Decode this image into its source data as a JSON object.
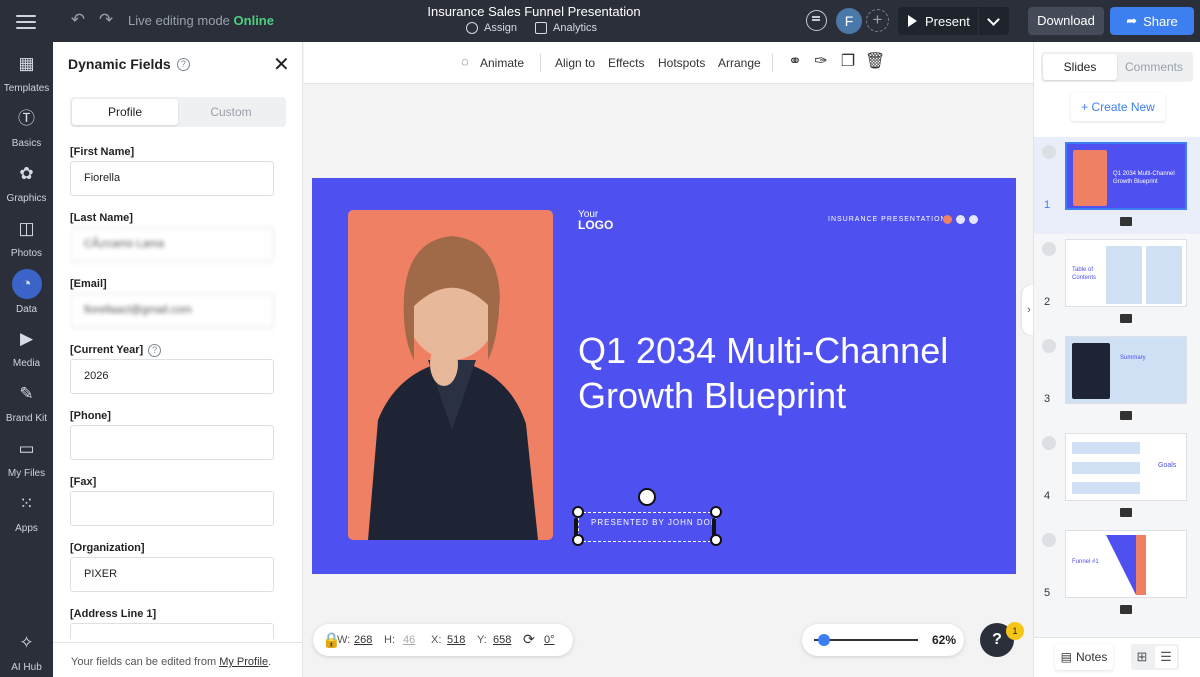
{
  "topbar": {
    "live_label": "Live editing mode",
    "live_status": "Online",
    "doc_title": "Insurance Sales Funnel Presentation",
    "assign": "Assign",
    "analytics": "Analytics",
    "avatar_initial": "F",
    "present": "Present",
    "download": "Download",
    "share": "Share"
  },
  "rail": [
    {
      "label": "Templates",
      "icon": "templates-icon"
    },
    {
      "label": "Basics",
      "icon": "basics-icon"
    },
    {
      "label": "Graphics",
      "icon": "graphics-icon"
    },
    {
      "label": "Photos",
      "icon": "photos-icon"
    },
    {
      "label": "Data",
      "icon": "data-icon"
    },
    {
      "label": "Media",
      "icon": "media-icon"
    },
    {
      "label": "Brand Kit",
      "icon": "brand-kit-icon"
    },
    {
      "label": "My Files",
      "icon": "my-files-icon"
    },
    {
      "label": "Apps",
      "icon": "apps-icon"
    },
    {
      "label": "AI Hub",
      "icon": "ai-hub-icon"
    }
  ],
  "panel": {
    "title": "Dynamic Fields",
    "tab_profile": "Profile",
    "tab_custom": "Custom",
    "fields": [
      {
        "label": "[First Name]",
        "value": "Fiorella"
      },
      {
        "label": "[Last Name]",
        "value": "CÃ¡rcamo Lama"
      },
      {
        "label": "[Email]",
        "value": "fiorellaacl@gmail.com"
      },
      {
        "label": "[Current Year]",
        "value": "2026"
      },
      {
        "label": "[Phone]",
        "value": ""
      },
      {
        "label": "[Fax]",
        "value": ""
      },
      {
        "label": "[Organization]",
        "value": "PIXER"
      },
      {
        "label": "[Address Line 1]",
        "value": ""
      }
    ],
    "footer_text": "Your fields can be edited from ",
    "footer_link": "My Profile",
    "footer_end": "."
  },
  "toolbar": {
    "animate": "Animate",
    "align": "Align to",
    "effects": "Effects",
    "hotspots": "Hotspots",
    "arrange": "Arrange"
  },
  "slide": {
    "logo_top": "Your",
    "logo_bottom": "LOGO",
    "kicker": "INSURANCE PRESENTATION",
    "title_line1": "Q1 2034 Multi-Channel",
    "title_line2": "Growth Blueprint",
    "presented_by": "PRESENTED BY JOHN DOE"
  },
  "dims": {
    "w_label": "W:",
    "w": "268",
    "h_label": "H:",
    "h": "46",
    "x_label": "X:",
    "x": "518",
    "y_label": "Y:",
    "y": "658",
    "rot": "0°"
  },
  "zoom": "62%",
  "help_badge": "1",
  "right_panel": {
    "tab_slides": "Slides",
    "tab_comments": "Comments",
    "create_new": "Create New",
    "notes": "Notes",
    "slides": [
      {
        "num": "1",
        "caption": "Q1 2034 Multi-Channel Growth Blueprint"
      },
      {
        "num": "2",
        "caption": "Table of Contents"
      },
      {
        "num": "3",
        "caption": "Summary"
      },
      {
        "num": "4",
        "caption": "Goals"
      },
      {
        "num": "5",
        "caption": "Funnel #1"
      }
    ]
  },
  "colors": {
    "accent": "#3d7ef0",
    "slide_bg": "#4e50ef",
    "slide_photo_bg": "#f08063",
    "online": "#4cd07d"
  }
}
